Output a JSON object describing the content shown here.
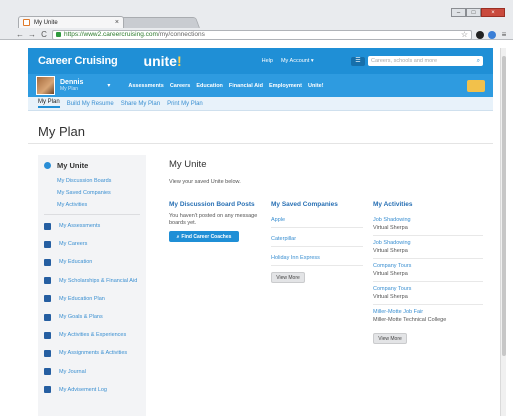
{
  "browser": {
    "tab_title": "My Unite",
    "tab_close": "×",
    "url_host": "https://www2.careercruising.com",
    "url_path": "/my/connections",
    "nav_back": "←",
    "nav_forward": "→",
    "nav_reload": "C"
  },
  "site": {
    "logo": "Career Cruising",
    "unite_main": "unite",
    "unite_bang": "!",
    "top_links": [
      "Help",
      "My Account ▾"
    ],
    "search_placeholder": "Careers, schools and more"
  },
  "user": {
    "name": "Dennis",
    "subtitle": "My Plan"
  },
  "main_nav": [
    "Assessments",
    "Careers",
    "Education",
    "Financial Aid",
    "Employment",
    "Unite!"
  ],
  "plan_tabs": [
    "My Plan",
    "Build My Resume",
    "Share My Plan",
    "Print My Plan"
  ],
  "page_title": "My Plan",
  "sidebar": {
    "heading": "My Unite",
    "sub_links": [
      "My Discussion Boards",
      "My Saved Companies",
      "My Activities"
    ],
    "items": [
      {
        "label": "My Assessments",
        "icon": "pencil-icon"
      },
      {
        "label": "My Careers",
        "icon": "briefcase-icon"
      },
      {
        "label": "My Education",
        "icon": "graduation-cap-icon"
      },
      {
        "label": "My Scholarships & Financial Aid",
        "icon": "money-icon"
      },
      {
        "label": "My Education Plan",
        "icon": "grid-icon"
      },
      {
        "label": "My Goals & Plans",
        "icon": "flag-icon"
      },
      {
        "label": "My Activities & Experiences",
        "icon": "checkbox-icon"
      },
      {
        "label": "My Assignments & Activities",
        "icon": "clipboard-icon"
      },
      {
        "label": "My Journal",
        "icon": "book-icon"
      },
      {
        "label": "My Advisement Log",
        "icon": "people-icon"
      }
    ]
  },
  "main": {
    "heading": "My Unite",
    "description": "View your saved Unite below.",
    "discussion": {
      "title": "My Discussion Board Posts",
      "text": "You haven't posted on any message boards yet.",
      "button": "Find Career Coaches"
    },
    "companies": {
      "title": "My Saved Companies",
      "items": [
        "Apple",
        "Caterpillar",
        "Holiday Inn Express"
      ],
      "view_more": "View More"
    },
    "activities": {
      "title": "My Activities",
      "items": [
        {
          "name": "Job Shadowing",
          "org": "Virtual Sherpa"
        },
        {
          "name": "Job Shadowing",
          "org": "Virtual Sherpa"
        },
        {
          "name": "Company Tours",
          "org": "Virtual Sherpa"
        },
        {
          "name": "Company Tours",
          "org": "Virtual Sherpa"
        },
        {
          "name": "Miller-Motte Job Fair",
          "org": "Miller-Motte Technical College"
        }
      ],
      "view_more": "View More"
    }
  },
  "colors": {
    "header_blue": "#1f8fd6",
    "subheader_blue": "#2e9be0",
    "link_blue": "#3a8fd1",
    "unite_bang": "#ffd04d"
  }
}
